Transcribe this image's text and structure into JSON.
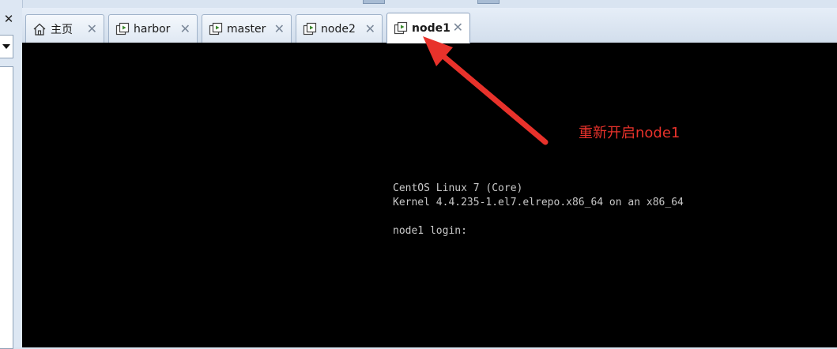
{
  "left_panel": {
    "close_glyph": "✕"
  },
  "tabs": [
    {
      "label": "主页",
      "icon": "home-icon",
      "close": "✕",
      "active": false
    },
    {
      "label": "harbor",
      "icon": "vm-icon",
      "close": "✕",
      "active": false
    },
    {
      "label": "master",
      "icon": "vm-icon",
      "close": "✕",
      "active": false
    },
    {
      "label": "node2",
      "icon": "vm-icon",
      "close": "✕",
      "active": false
    },
    {
      "label": "node1",
      "icon": "vm-icon",
      "close": "✕",
      "active": true
    }
  ],
  "console": {
    "lines": [
      "CentOS Linux 7 (Core)",
      "Kernel 4.4.235-1.el7.elrepo.x86_64 on an x86_64",
      "",
      "node1 login:"
    ]
  },
  "annotation": {
    "text": "重新开启node1",
    "color": "#e8322b"
  },
  "colors": {
    "console_bg": "#000000",
    "console_fg": "#c8c8c8",
    "tabbar_bg": "#dbe5f1"
  }
}
